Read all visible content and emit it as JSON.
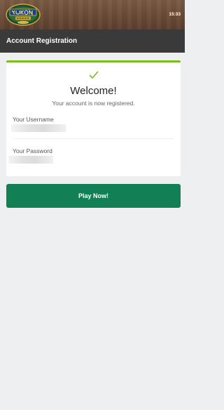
{
  "header": {
    "logo_icon": "yukon-gold-casino-logo",
    "time": "15:33"
  },
  "titlebar": {
    "title": "Account Registration"
  },
  "card": {
    "icon": "check-icon",
    "heading": "Welcome!",
    "subheading": "Your account is now registered.",
    "username_label": "Your Username",
    "password_label": "Your Password"
  },
  "actions": {
    "play_label": "Play Now!"
  },
  "colors": {
    "accent_green": "#7cbc1e",
    "button_green": "#128054",
    "titlebar": "#3a3a3a",
    "background": "#eeeff1"
  }
}
